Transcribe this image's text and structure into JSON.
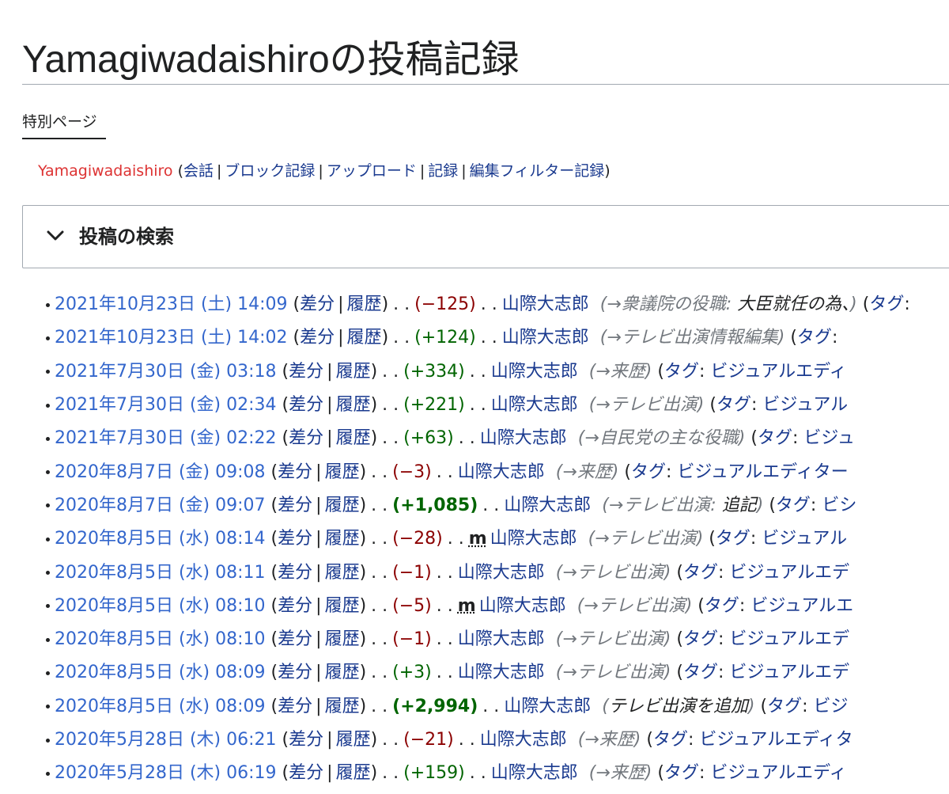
{
  "page_title": "Yamagiwadaishiroの投稿記録",
  "tab": "特別ページ",
  "user_nav": {
    "user": "Yamagiwadaishiro",
    "open": " (",
    "links": [
      "会話",
      "ブロック記録",
      "アップロード",
      "記録",
      "編集フィルター記録"
    ],
    "close": ")"
  },
  "search_section": {
    "label": "投稿の検索"
  },
  "labels": {
    "diff": "差分",
    "history": "履歴",
    "minor": "m",
    "tag": "タグ"
  },
  "contributions": [
    {
      "date": "2021年10月23日 (土) 14:09",
      "delta": "(−125)",
      "sign": "neg",
      "big": false,
      "minor": false,
      "page": "山際大志郎",
      "section": "→衆議院の役職:",
      "summary": " 大臣就任の為、",
      "tag": ""
    },
    {
      "date": "2021年10月23日 (土) 14:02",
      "delta": "(+124)",
      "sign": "pos",
      "big": false,
      "minor": false,
      "page": "山際大志郎",
      "section": "→テレビ出演情報編集",
      "summary": "",
      "tag": " "
    },
    {
      "date": "2021年7月30日 (金) 03:18",
      "delta": "(+334)",
      "sign": "pos",
      "big": false,
      "minor": false,
      "page": "山際大志郎",
      "section": "→来歴",
      "summary": "",
      "tag": "ビジュアルエディ"
    },
    {
      "date": "2021年7月30日 (金) 02:34",
      "delta": "(+221)",
      "sign": "pos",
      "big": false,
      "minor": false,
      "page": "山際大志郎",
      "section": "→テレビ出演",
      "summary": "",
      "tag": "ビジュアル"
    },
    {
      "date": "2021年7月30日 (金) 02:22",
      "delta": "(+63)",
      "sign": "pos",
      "big": false,
      "minor": false,
      "page": "山際大志郎",
      "section": "→自民党の主な役職",
      "summary": "",
      "tag": "ビジュ"
    },
    {
      "date": "2020年8月7日 (金) 09:08",
      "delta": "(−3)",
      "sign": "neg",
      "big": false,
      "minor": false,
      "page": "山際大志郎",
      "section": "→来歴",
      "summary": "",
      "tag": "ビジュアルエディター"
    },
    {
      "date": "2020年8月7日 (金) 09:07",
      "delta": "(+1,085)",
      "sign": "pos",
      "big": true,
      "minor": false,
      "page": "山際大志郎",
      "section": "→テレビ出演:",
      "summary": " 追記",
      "tag": "ビシ"
    },
    {
      "date": "2020年8月5日 (水) 08:14",
      "delta": "(−28)",
      "sign": "neg",
      "big": false,
      "minor": true,
      "page": "山際大志郎",
      "section": "→テレビ出演",
      "summary": "",
      "tag": "ビジュアル"
    },
    {
      "date": "2020年8月5日 (水) 08:11",
      "delta": "(−1)",
      "sign": "neg",
      "big": false,
      "minor": false,
      "page": "山際大志郎",
      "section": "→テレビ出演",
      "summary": "",
      "tag": "ビジュアルエデ"
    },
    {
      "date": "2020年8月5日 (水) 08:10",
      "delta": "(−5)",
      "sign": "neg",
      "big": false,
      "minor": true,
      "page": "山際大志郎",
      "section": "→テレビ出演",
      "summary": "",
      "tag": "ビジュアルエ"
    },
    {
      "date": "2020年8月5日 (水) 08:10",
      "delta": "(−1)",
      "sign": "neg",
      "big": false,
      "minor": false,
      "page": "山際大志郎",
      "section": "→テレビ出演",
      "summary": "",
      "tag": "ビジュアルエデ"
    },
    {
      "date": "2020年8月5日 (水) 08:09",
      "delta": "(+3)",
      "sign": "pos",
      "big": false,
      "minor": false,
      "page": "山際大志郎",
      "section": "→テレビ出演",
      "summary": "",
      "tag": "ビジュアルエデ"
    },
    {
      "date": "2020年8月5日 (水) 08:09",
      "delta": "(+2,994)",
      "sign": "pos",
      "big": true,
      "minor": false,
      "page": "山際大志郎",
      "section": "",
      "summary": "テレビ出演を追加",
      "tag": "ビジ"
    },
    {
      "date": "2020年5月28日 (木) 06:21",
      "delta": "(−21)",
      "sign": "neg",
      "big": false,
      "minor": false,
      "page": "山際大志郎",
      "section": "→来歴",
      "summary": "",
      "tag": "ビジュアルエディタ"
    },
    {
      "date": "2020年5月28日 (木) 06:19",
      "delta": "(+159)",
      "sign": "pos",
      "big": false,
      "minor": false,
      "page": "山際大志郎",
      "section": "→来歴",
      "summary": "",
      "tag": "ビジュアルエディ"
    }
  ]
}
